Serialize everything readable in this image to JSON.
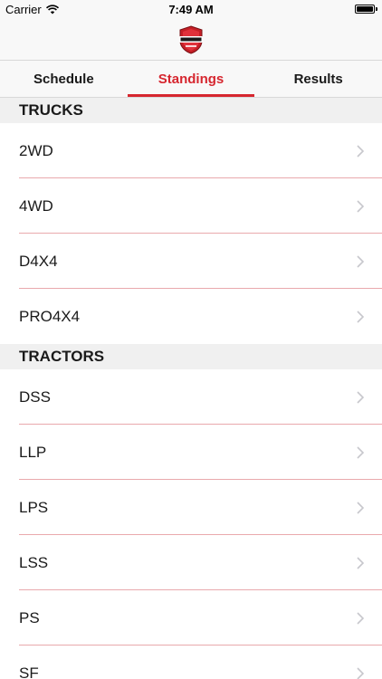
{
  "status_bar": {
    "carrier": "Carrier",
    "time": "7:49 AM"
  },
  "nav": {
    "logo_icon": "outlaw-logo-icon"
  },
  "tabs": [
    {
      "label": "Schedule",
      "active": false
    },
    {
      "label": "Standings",
      "active": true
    },
    {
      "label": "Results",
      "active": false
    }
  ],
  "sections": [
    {
      "title": "TRUCKS",
      "items": [
        {
          "label": "2WD"
        },
        {
          "label": "4WD"
        },
        {
          "label": "D4X4"
        },
        {
          "label": "PRO4X4"
        }
      ]
    },
    {
      "title": "TRACTORS",
      "items": [
        {
          "label": "DSS"
        },
        {
          "label": "LLP"
        },
        {
          "label": "LPS"
        },
        {
          "label": "LSS"
        },
        {
          "label": "PS"
        },
        {
          "label": "SF"
        }
      ]
    }
  ],
  "colors": {
    "accent": "#d6262f",
    "separator": "#e9a9ad",
    "section_bg": "#f0f0f0"
  }
}
